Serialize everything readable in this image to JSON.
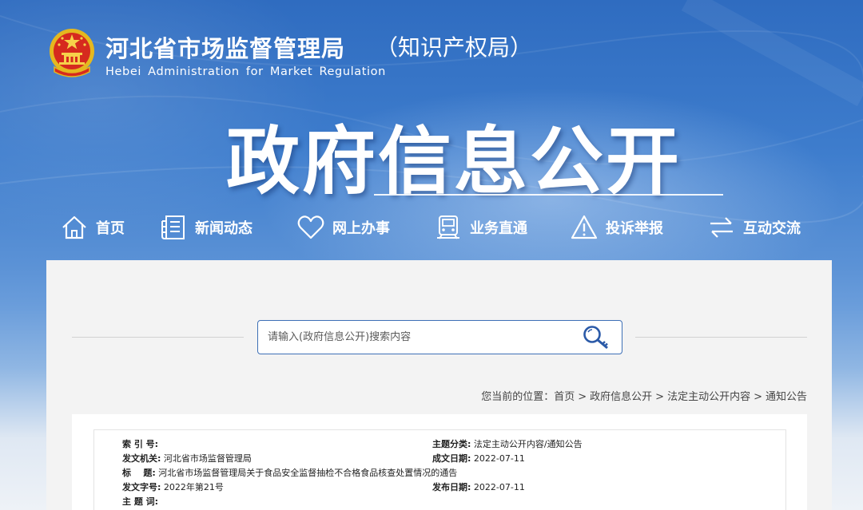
{
  "header": {
    "org_name_cn": "河北省市场监督管理局",
    "org_subtitle": "（知识产权局）",
    "org_name_en": "Hebei  Administration  for  Market  Regulation",
    "hero_title": "政府信息公开"
  },
  "nav": {
    "items": [
      {
        "label": "首页",
        "icon": "home-icon"
      },
      {
        "label": "新闻动态",
        "icon": "news-icon"
      },
      {
        "label": "网上办事",
        "icon": "heart-icon"
      },
      {
        "label": "业务直通",
        "icon": "train-icon"
      },
      {
        "label": "投诉举报",
        "icon": "warning-icon"
      },
      {
        "label": "互动交流",
        "icon": "exchange-icon"
      }
    ]
  },
  "search": {
    "placeholder": "请输入(政府信息公开)搜索内容",
    "icon": "search-key-icon"
  },
  "breadcrumb": {
    "prefix": "您当前的位置：",
    "items": [
      "首页",
      "政府信息公开",
      "法定主动公开内容",
      "通知公告"
    ],
    "separator": ">"
  },
  "meta": {
    "index_label": "索 引 号:",
    "index_value": "",
    "category_label": "主题分类:",
    "category_value": "法定主动公开内容/通知公告",
    "issuer_label": "发文机关:",
    "issuer_value": "河北省市场监督管理局",
    "created_label": "成文日期:",
    "created_value": "2022-07-11",
    "title_label": "标    题:",
    "title_value": "河北省市场监督管理局关于食品安全监督抽检不合格食品核查处置情况的通告",
    "docno_label": "发文字号:",
    "docno_value": "2022年第21号",
    "published_label": "发布日期:",
    "published_value": "2022-07-11",
    "keywords_label": "主 题 词:",
    "keywords_value": ""
  },
  "colors": {
    "header_blue": "#2f6cc0",
    "search_border": "#3d6fb6",
    "panel_bg": "#f3f3f3"
  }
}
